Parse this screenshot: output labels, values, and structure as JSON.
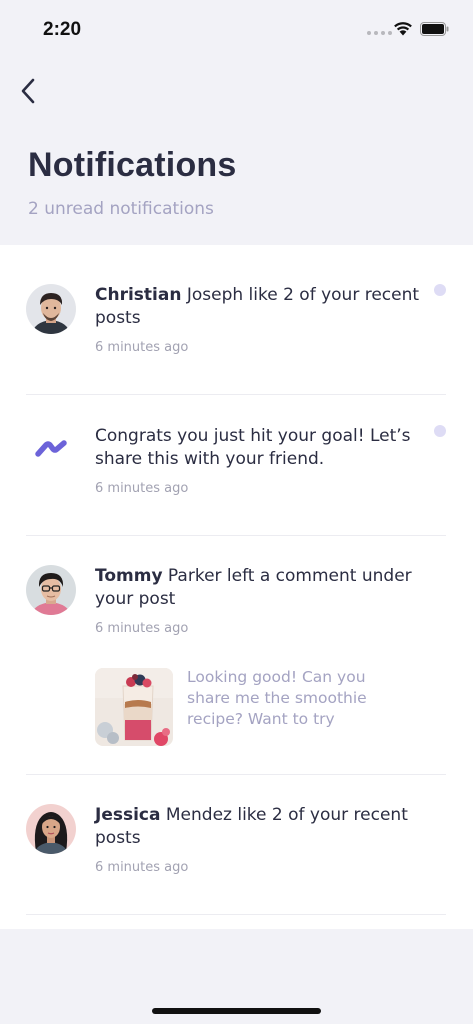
{
  "status_bar": {
    "time": "2:20"
  },
  "header": {
    "title": "Notifications",
    "subtitle": "2 unread notifications"
  },
  "notifications": [
    {
      "first_name": "Christian",
      "message": " Joseph like 2 of your recent posts",
      "time": "6 minutes ago",
      "unread": true,
      "avatar": "avatar-christian"
    },
    {
      "first_name": "",
      "message": "Congrats you just hit your goal! Let’s share this with your friend.",
      "time": "6 minutes ago",
      "unread": true,
      "icon": "goal-icon",
      "accent_color": "#6c63d9"
    },
    {
      "first_name": "Tommy",
      "message": " Parker left a comment under your post",
      "time": "6 minutes ago",
      "unread": false,
      "avatar": "avatar-tommy",
      "comment": "Looking good! Can you share me the smoothie recipe? Want to try"
    },
    {
      "first_name": "Jessica",
      "message": " Mendez like 2 of your recent posts",
      "time": "6 minutes ago",
      "unread": false,
      "avatar": "avatar-jessica"
    }
  ],
  "icons": {
    "back": "chevron-left-icon",
    "wifi": "wifi-icon",
    "battery": "battery-icon",
    "signal": "signal-dots-icon"
  },
  "colors": {
    "accent": "#6c63d9",
    "unread_dot": "#dedcf5",
    "subtitle": "#a4a3c2",
    "background": "#f2f2f7"
  }
}
